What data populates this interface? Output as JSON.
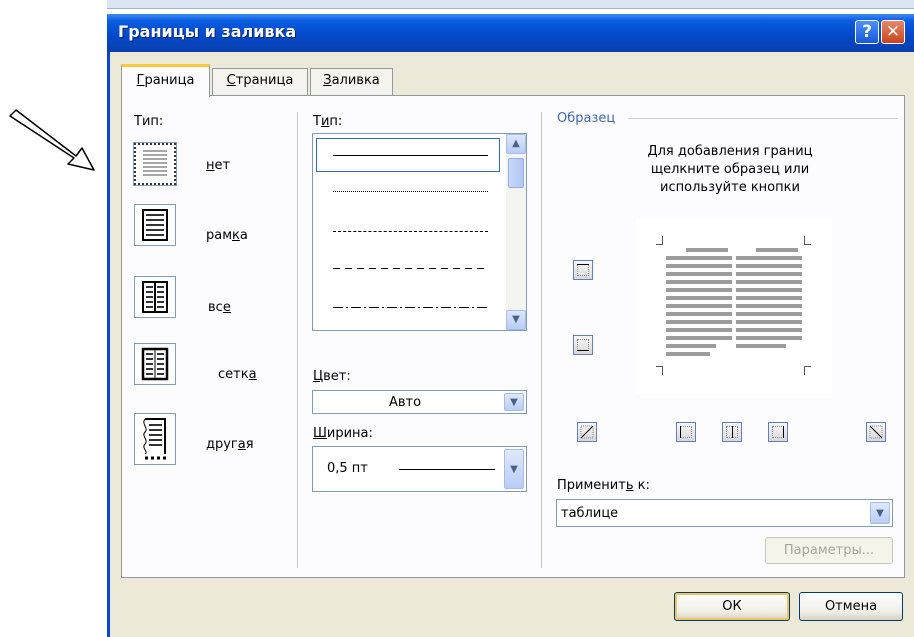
{
  "window": {
    "title": "Границы и заливка",
    "help_glyph": "?",
    "close_glyph": "✕"
  },
  "tabs": [
    {
      "label": "Граница",
      "accel": "Г",
      "rest": "раница",
      "active": true
    },
    {
      "label": "Страница",
      "accel": "С",
      "rest": "траница",
      "active": false
    },
    {
      "label": "Заливка",
      "accel": "З",
      "rest": "аливка",
      "active": false
    }
  ],
  "settings": {
    "label": "Тип:",
    "items": [
      {
        "pre": "",
        "accel": "н",
        "post": "ет",
        "icon": "border-none-icon",
        "selected": true
      },
      {
        "pre": "рам",
        "accel": "к",
        "post": "а",
        "icon": "border-box-icon",
        "selected": false
      },
      {
        "pre": "вс",
        "accel": "е",
        "post": "",
        "icon": "border-all-icon",
        "selected": false
      },
      {
        "pre": "сетк",
        "accel": "а",
        "post": "",
        "icon": "border-grid-icon",
        "selected": false
      },
      {
        "pre": "друг",
        "accel": "а",
        "post": "я",
        "icon": "border-custom-icon",
        "selected": false
      }
    ]
  },
  "style": {
    "label_pre": "Т",
    "label_accel": "и",
    "label_post": "п:",
    "items": [
      "solid",
      "dotted",
      "dash-small",
      "dashed",
      "dash-dot"
    ]
  },
  "color": {
    "label_pre": "",
    "label_accel": "Ц",
    "label_post": "вет:",
    "value": "Авто"
  },
  "width": {
    "label_pre": "",
    "label_accel": "Ш",
    "label_post": "ирина:",
    "value": "0,5 пт"
  },
  "preview": {
    "label": "Образец",
    "hint_lines": [
      "Для добавления границ",
      "щелкните образец или",
      "используйте кнопки"
    ]
  },
  "apply_to": {
    "label_pre": "Применит",
    "label_accel": "ь",
    "label_post": " к:",
    "value": "таблице"
  },
  "buttons": {
    "options": "Параметры...",
    "ok": "ОК",
    "cancel": "Отмена"
  },
  "colors": {
    "title_bar": "#0348c8",
    "dialog_bg": "#ece9d8",
    "tab_highlight": "#ffc83c"
  }
}
